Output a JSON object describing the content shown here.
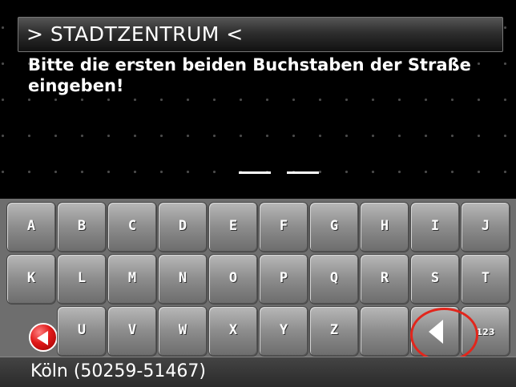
{
  "header": {
    "title": "> STADTZENTRUM <"
  },
  "prompt": {
    "text": "Bitte die ersten beiden Buchstaben der Straße eingeben!"
  },
  "input": {
    "slot_count": 2
  },
  "keyboard": {
    "row1": [
      "A",
      "B",
      "C",
      "D",
      "E",
      "F",
      "G",
      "H",
      "I",
      "J"
    ],
    "row2": [
      "K",
      "L",
      "M",
      "N",
      "O",
      "P",
      "Q",
      "R",
      "S",
      "T"
    ],
    "row3": [
      "U",
      "V",
      "W",
      "X",
      "Y",
      "Z"
    ],
    "back_icon": "back-arrow-icon",
    "delete_icon": "delete-arrow-icon",
    "numeric_label": "123"
  },
  "status": {
    "location": "Köln (50259-51467)"
  },
  "colors": {
    "highlight": "#e2261c",
    "back_button": "#e01818"
  }
}
